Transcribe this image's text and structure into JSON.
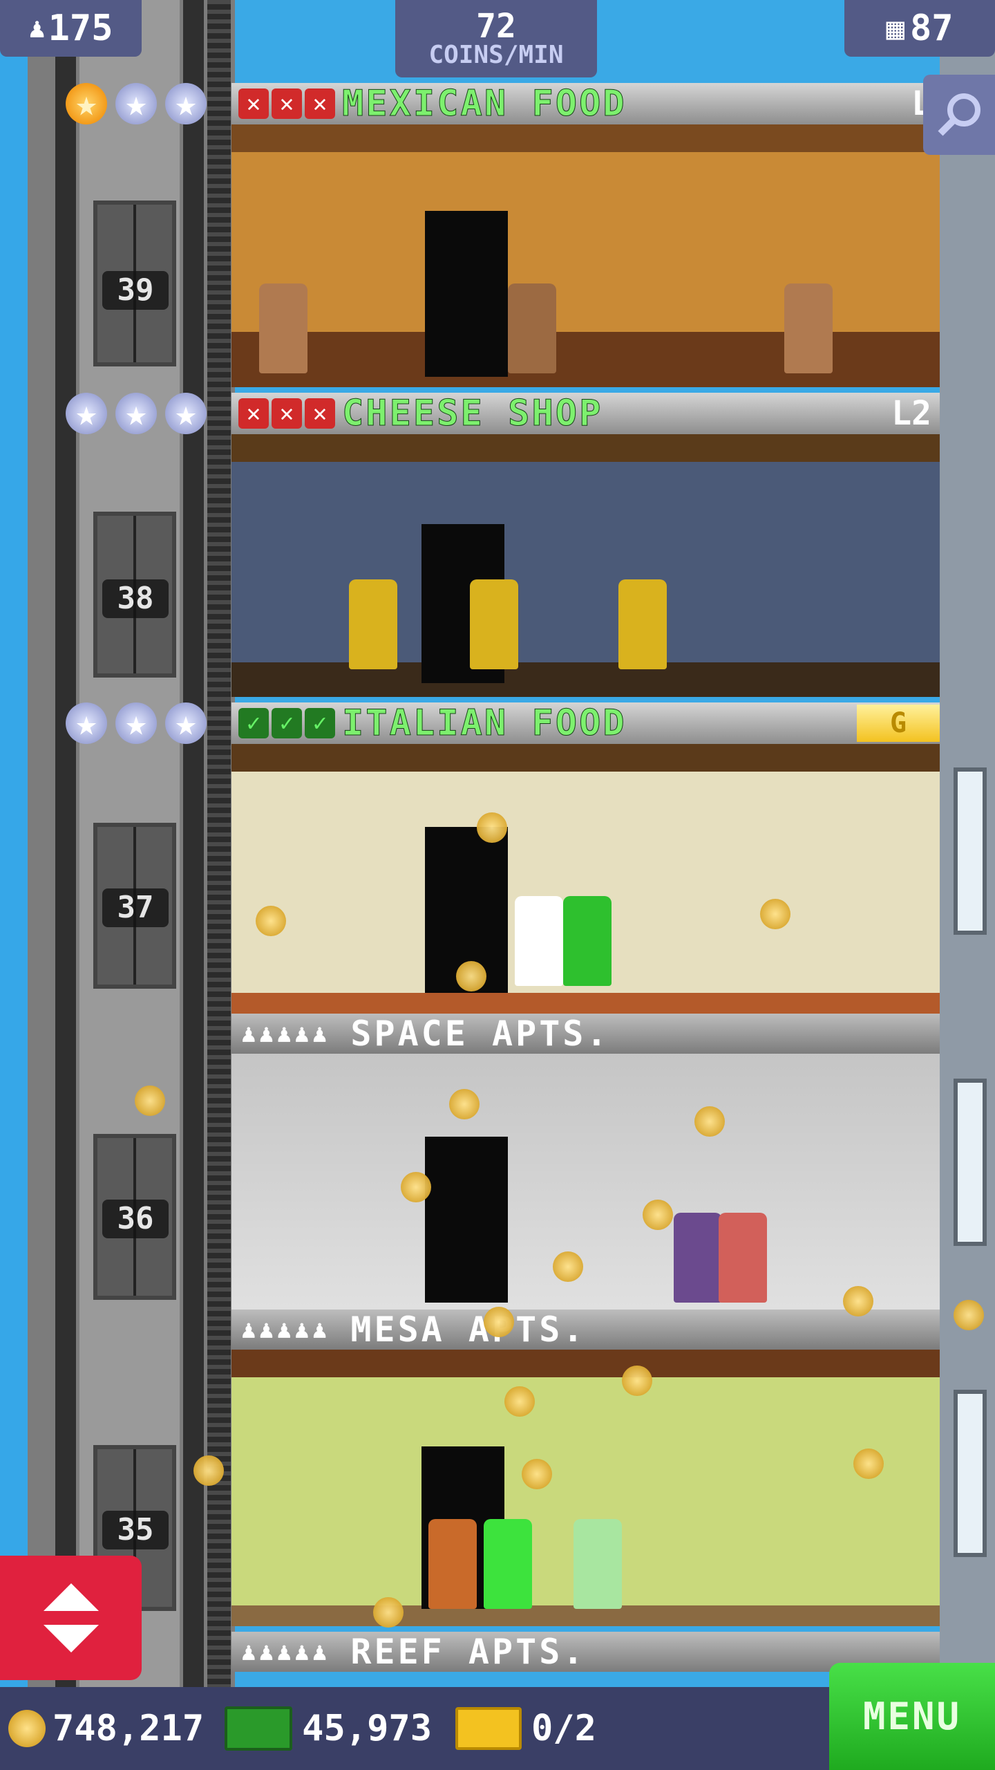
{
  "hud": {
    "population": "175",
    "coins_per_min_value": "72",
    "coins_per_min_label": "COINS/MIN",
    "floors": "87"
  },
  "floors": {
    "mexican": {
      "name": "MEXICAN FOOD",
      "level": "L",
      "stars_gold": 1,
      "stars_total": 3,
      "tasks": [
        "x",
        "x",
        "x"
      ],
      "number": "39"
    },
    "cheese": {
      "name": "CHEESE SHOP",
      "level": "L2",
      "stars_gold": 0,
      "stars_total": 3,
      "tasks": [
        "x",
        "x",
        "x"
      ],
      "number": "38"
    },
    "italian": {
      "name": "ITALIAN FOOD",
      "badge": "G",
      "stars_gold": 0,
      "stars_total": 3,
      "tasks": [
        "ok",
        "ok",
        "ok"
      ],
      "number": "37"
    },
    "space": {
      "name": "SPACE APTS.",
      "number": "36"
    },
    "mesa": {
      "name": "MESA APTS.",
      "number": "35"
    },
    "reef": {
      "name": "REEF APTS."
    }
  },
  "bottom": {
    "coins": "748,217",
    "bux": "45,973",
    "tickets": "0/2",
    "menu_label": "MENU"
  },
  "colors": {
    "name_green": "#7df06e",
    "task_fail": "#d12a2a",
    "task_ok": "#227a22",
    "menu_green": "#33c433"
  }
}
